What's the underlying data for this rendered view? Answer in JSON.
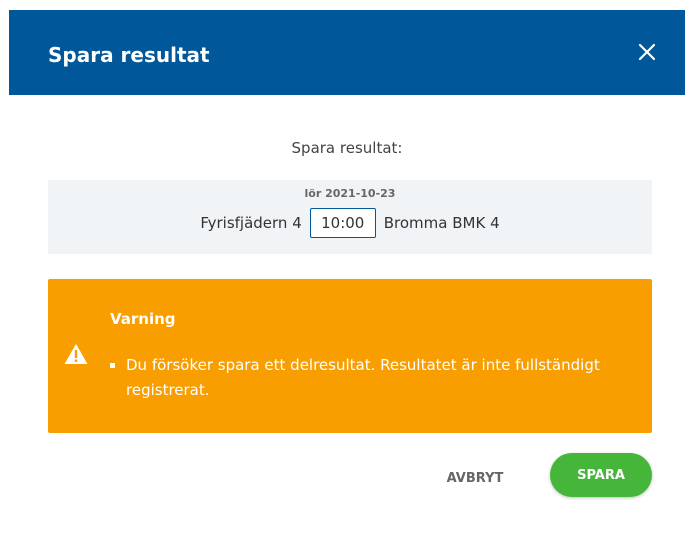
{
  "dialog": {
    "title": "Spara resultat",
    "close_icon": "close-icon",
    "subtitle": "Spara resultat:"
  },
  "match": {
    "date": "lör 2021-10-23",
    "home_team": "Fyrisfjädern 4",
    "time_value": "10:00",
    "away_team": "Bromma BMK 4"
  },
  "warning": {
    "icon": "warning-triangle-icon",
    "title": "Varning",
    "messages": [
      "Du försöker spara ett delresultat. Resultatet är inte fullständigt registrerat."
    ]
  },
  "actions": {
    "cancel_label": "AVBRYT",
    "save_label": "SPARA"
  },
  "colors": {
    "header_bg": "#005799",
    "warning_bg": "#f89e00",
    "save_bg": "#46b63b",
    "match_bg": "#f1f4f7"
  }
}
